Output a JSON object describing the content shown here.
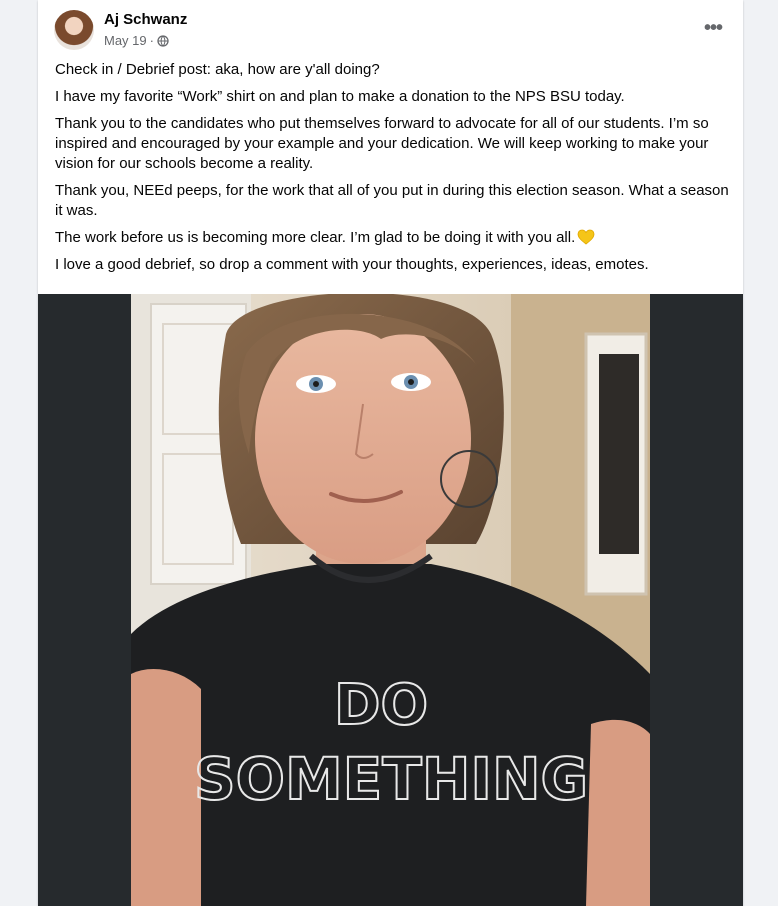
{
  "post": {
    "author": "Aj Schwanz",
    "date": "May 19",
    "separator": "·",
    "privacy_icon": "globe-icon",
    "more_icon": "more-options-icon",
    "more_label": "•••",
    "paragraphs": [
      "Check in / Debrief post: aka, how are y'all doing?",
      "I have my favorite “Work” shirt on and plan to make a donation to the NPS BSU today.",
      "Thank you to the candidates who put themselves forward to advocate for all of our students. I’m so inspired and encouraged by your example and your dedication. We will keep working to make your vision for our schools become a reality.",
      "Thank you, NEEd peeps, for the work that all of you put in during this election season. What a season it was.",
      "The work before us is becoming more clear. I’m glad to be doing it with you all.",
      "I love a good debrief, so drop a comment with your thoughts, experiences, ideas, emotes."
    ],
    "emoji_icon": "yellow-heart-icon",
    "photo": {
      "shirt_text_line1": "DO",
      "shirt_text_line2": "SOMETHING"
    }
  },
  "colors": {
    "page_bg": "#f0f2f5",
    "card_bg": "#ffffff",
    "text": "#050505",
    "secondary_text": "#65676b",
    "photo_backdrop": "#262a2d",
    "heart": "#f5c518"
  }
}
